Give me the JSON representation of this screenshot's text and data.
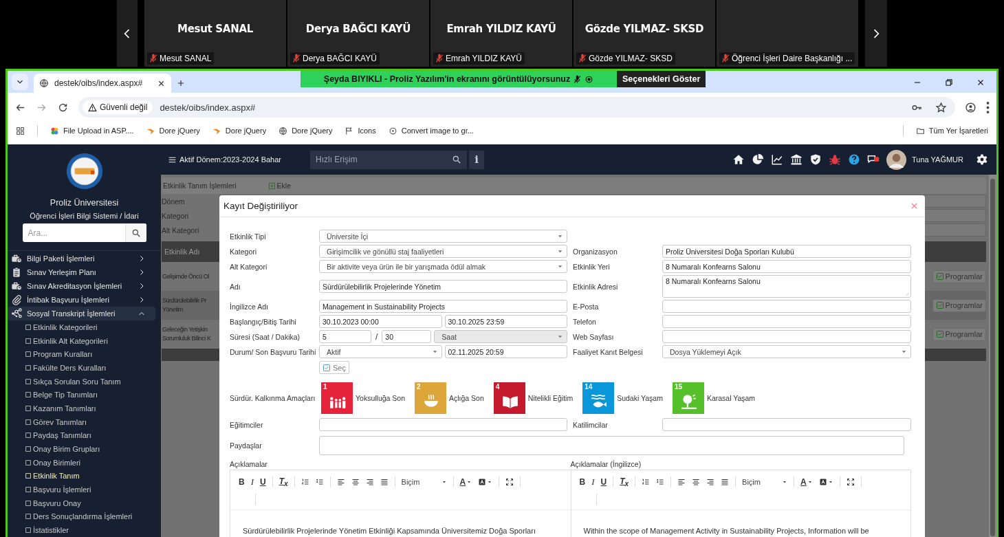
{
  "meeting": {
    "participants": [
      {
        "name": "Mesut SANAL",
        "label": "Mesut SANAL",
        "muted": true
      },
      {
        "name": "Derya BAĞCI KAYÜ",
        "label": "Derya BAĞCI KAYÜ",
        "muted": true
      },
      {
        "name": "Emrah YILDIZ KAYÜ",
        "label": "Emrah YILDIZ KAYÜ",
        "muted": true
      },
      {
        "name": "Gözde YILMAZ- SKSD",
        "label": "Gözde YILMAZ- SKSD",
        "muted": true
      },
      {
        "label": "Öğrenci İşleri Daire Başkanlığı ...",
        "muted": true
      }
    ]
  },
  "screen_share": {
    "message": "Şeyda BIYIKLI - Proliz Yazılım'in ekranını görüntülüyorsunuz",
    "options": "Seçenekleri Göster"
  },
  "browser": {
    "tab": {
      "title": "destek/oibs/index.aspx#"
    },
    "security": "Güvenli değil",
    "url": "destek/oibs/index.aspx#",
    "bookmarks": [
      "File Upload in ASP....",
      "Dore jQuery",
      "Dore jQuery",
      "Dore jQuery",
      "Icons",
      "Convert image to gr..."
    ],
    "all_bookmarks": "Tüm Yer İşaretleri"
  },
  "sidebar": {
    "university": "Proliz Üniversitesi",
    "system": "Öğrenci İşleri Bilgi Sistemi / İdari",
    "search": {
      "placeholder": "Ara..."
    },
    "items": [
      {
        "label": "Bilgi Paketi İşlemleri",
        "expanded": false
      },
      {
        "label": "Sınav Yerleşim Planı",
        "expanded": false
      },
      {
        "label": "Sınav Akreditasyon İşlemleri",
        "expanded": false
      },
      {
        "label": "İntibak Başvuru İşlemleri",
        "expanded": false
      },
      {
        "label": "Sosyal Transkript İşlemleri",
        "expanded": true,
        "children": [
          {
            "label": "Etkinlik Kategorileri",
            "selected": false
          },
          {
            "label": "Etkinlik Alt Kategorileri",
            "selected": false
          },
          {
            "label": "Program Kuralları",
            "selected": false
          },
          {
            "label": "Fakülte Ders Kuralları",
            "selected": false
          },
          {
            "label": "Sıkça Sorulan Soru Tanım",
            "selected": false
          },
          {
            "label": "Belge Tip Tanımları",
            "selected": false
          },
          {
            "label": "Kazanım Tanımları",
            "selected": false
          },
          {
            "label": "Görev Tanımları",
            "selected": false
          },
          {
            "label": "Paydaş Tanımları",
            "selected": false
          },
          {
            "label": "Onay Birim Grupları",
            "selected": false
          },
          {
            "label": "Onay Birimleri",
            "selected": false
          },
          {
            "label": "Etkinlik Tanım",
            "selected": true
          },
          {
            "label": "Başvuru İşlemleri",
            "selected": false
          },
          {
            "label": "Başvuru Onay",
            "selected": false
          },
          {
            "label": "Ders Sonuçlandırma İşlemleri",
            "selected": false
          },
          {
            "label": "İstatistikler",
            "selected": false
          }
        ]
      }
    ]
  },
  "topbar": {
    "term": "Aktif Dönem:2023-2024 Bahar",
    "search": {
      "placeholder": "Hızlı Erişim"
    },
    "info": "i",
    "user": "Tuna YAĞMUR"
  },
  "page": {
    "title": "Etkinlik Tanım İşlemleri",
    "add": "Ekle",
    "filters": [
      "Dönem",
      "Kategori",
      "Alt Kategori"
    ],
    "table": {
      "columns": [
        "Etkinlik Adı"
      ],
      "rows": [
        {
          "lines": [
            "Gelişimde Öncü Ol"
          ],
          "action": "Programlar"
        },
        {
          "lines": [
            "Sürdürülebilirlik Pr",
            "Yönetim"
          ],
          "action": "Programlar"
        },
        {
          "lines": [
            "Geleceğin Yetişkin",
            "Sorumluluk Bilinci K"
          ],
          "action": "Programlar"
        }
      ]
    }
  },
  "modal": {
    "title": "Kayıt Değiştiriliyor",
    "rows": [
      {
        "label": "Etkinlik Tipi",
        "fields": [
          {
            "kind": "select",
            "value": "Üniversite İçi",
            "disabled": false
          }
        ]
      },
      {
        "label": "Kategori",
        "fields": [
          {
            "kind": "select",
            "value": "Girişimcilik ve gönüllü staj faaliyetleri",
            "disabled": false
          }
        ],
        "side": {
          "label": "Organizasyon",
          "field": {
            "kind": "input",
            "value": "Proliz Üniversitesi Doğa Sporları Kulubü",
            "disabled": false
          }
        }
      },
      {
        "label": "Alt Kategori",
        "fields": [
          {
            "kind": "select",
            "value": "Bir aktivite veya ürün ile bir yarışmada ödül almak",
            "disabled": false
          }
        ],
        "side": {
          "label": "Etkinlik Yeri",
          "field": {
            "kind": "input",
            "value": "8 Numaralı Konfearns Salonu",
            "disabled": false
          }
        }
      },
      {
        "label": "Adı",
        "fields": [
          {
            "kind": "input",
            "value": "Sürdürülebilirlik Projelerinde Yönetim",
            "disabled": false
          }
        ],
        "side": {
          "label": "Etkinlik Adresi",
          "field": {
            "kind": "textarea",
            "value": "8 Numaralı Konfearns Salonu",
            "disabled": false
          }
        }
      },
      {
        "label": "İngilizce Adı",
        "fields": [
          {
            "kind": "input",
            "value": "Management in Sustainability Projects",
            "disabled": false
          }
        ],
        "side": {
          "label": "E-Posta",
          "field": {
            "kind": "input",
            "disabled": false
          }
        }
      },
      {
        "label": "Başlangıç/Bitiş Tarihi",
        "fields": [
          {
            "kind": "input",
            "value": "30.10.2023 00:00",
            "disabled": false
          },
          {
            "kind": "input",
            "value": "30.10.2025 23:59",
            "disabled": false
          }
        ],
        "side": {
          "label": "Telefon",
          "field": {
            "kind": "input",
            "disabled": false
          }
        }
      },
      {
        "label": "Süresi (Saat / Dakika)",
        "fields": [
          {
            "kind": "input",
            "value": "5",
            "disabled": false
          },
          {
            "kind": "separator",
            "value": "/"
          },
          {
            "kind": "input",
            "value": "30",
            "disabled": false
          },
          {
            "kind": "select",
            "value": "Saat",
            "disabled": true
          }
        ],
        "side": {
          "label": "Web Sayfası",
          "field": {
            "kind": "input",
            "disabled": false
          }
        }
      },
      {
        "label": "Durum/ Son Başvuru Tarihi",
        "fields": [
          {
            "kind": "select",
            "value": "Aktif",
            "disabled": false
          },
          {
            "kind": "input",
            "value": "02.11.2025 20:59",
            "disabled": false
          }
        ],
        "side": {
          "label": "Faaliyet Kanıt Belgesi",
          "field": {
            "kind": "select",
            "value": "Dosya Yüklemeyi Açık",
            "disabled": false
          }
        }
      }
    ],
    "select_button": {
      "label": "Seç",
      "checked": true
    },
    "goals": {
      "label": "Sürdür. Kalkınma Amaçları",
      "items": [
        {
          "number": "1",
          "label": "Yoksulluğa Son",
          "color": "#e5243b"
        },
        {
          "number": "2",
          "label": "Açlığa Son",
          "color": "#dda63a"
        },
        {
          "number": "4",
          "label": "Nitelikli Eğitim",
          "color": "#c5192d"
        },
        {
          "number": "14",
          "label": "Sudaki Yaşam",
          "color": "#0a97d9"
        },
        {
          "number": "15",
          "label": "Karasal Yaşam",
          "color": "#56c02b"
        }
      ]
    },
    "trainers": {
      "label": "Eğitimciler"
    },
    "attendees": {
      "label": "Katilimcilar"
    },
    "stakeholders": {
      "label": "Paydaşlar"
    },
    "editors": [
      {
        "label": "Açıklamalar",
        "toolbar": {
          "bold": "B",
          "italic": "I",
          "underline": "U",
          "clear": "T$_{x}$",
          "format": "Biçim",
          "text_color_label": "A"
        },
        "text": "Sürdürülebilirlik Projelerinde Yönetim Etkinliği Kapsamında Üniversitemiz Doğa Sporları"
      },
      {
        "label": "Açıklamalar (İngilizce)",
        "toolbar": {
          "bold": "B",
          "italic": "I",
          "underline": "U",
          "clear": "T$_{x}$",
          "format": "Biçim",
          "text_color_label": "A"
        },
        "text": "Within the scope of Management Activity in Sustainability Projects, Information will be"
      }
    ]
  }
}
